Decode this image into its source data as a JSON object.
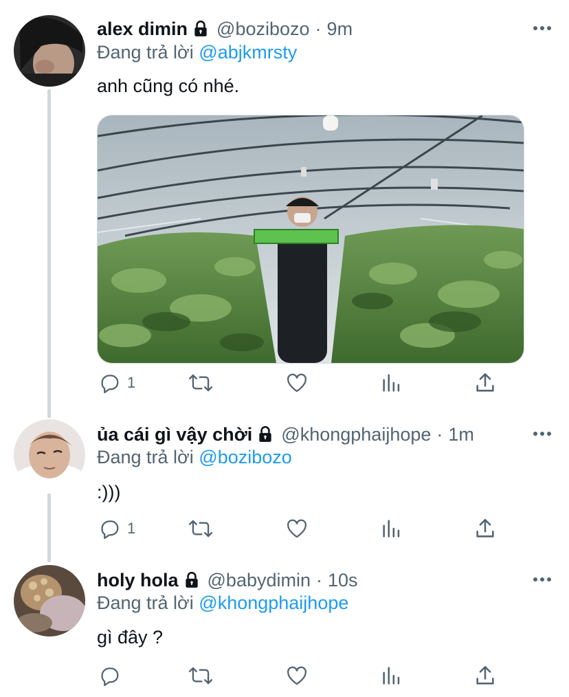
{
  "tweets": [
    {
      "name": "alex dimin",
      "handle": "@bozibozo",
      "time": "9m",
      "replying_label": "Đang trả lời",
      "replying_to": "@abjkmrsty",
      "text": "anh cũng có nhé.",
      "reply_count": "1",
      "avatar_icon": "user-avatar"
    },
    {
      "name": "ủa cái gì vậy chời",
      "handle": "@khongphaijhope",
      "time": "1m",
      "replying_label": "Đang trả lời",
      "replying_to": "@bozibozo",
      "text": ":)))",
      "reply_count": "1",
      "avatar_icon": "user-avatar"
    },
    {
      "name": "holy hola",
      "handle": "@babydimin",
      "time": "10s",
      "replying_label": "Đang trả lời",
      "replying_to": "@khongphaijhope",
      "text": "gì đây ?",
      "reply_count": "",
      "avatar_icon": "user-avatar"
    }
  ],
  "separator": "·",
  "icons": [
    "lock-icon",
    "more-icon",
    "reply-icon",
    "retweet-icon",
    "like-icon",
    "analytics-icon",
    "share-icon"
  ],
  "colors": {
    "link": "#1d9bf0",
    "secondary_text": "#536471",
    "thread_line": "#cfd9de"
  }
}
